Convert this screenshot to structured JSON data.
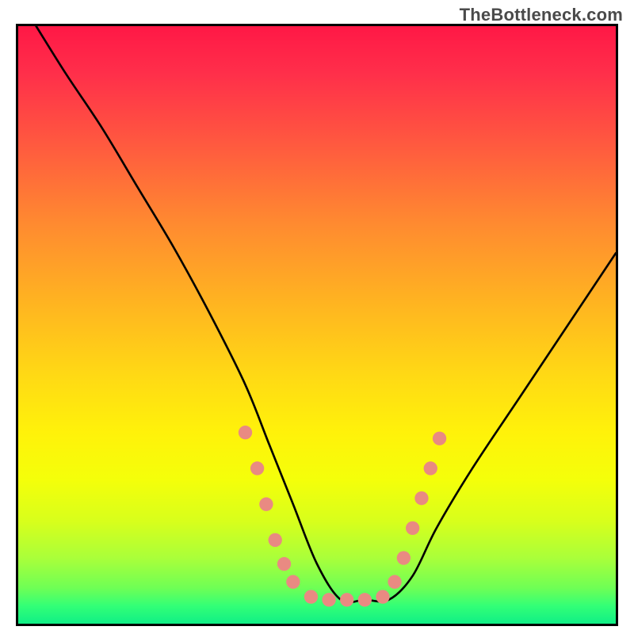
{
  "watermark": "TheBottleneck.com",
  "chart_data": {
    "type": "line",
    "title": "",
    "xlabel": "",
    "ylabel": "",
    "xlim": [
      0,
      100
    ],
    "ylim": [
      0,
      100
    ],
    "grid": false,
    "series": [
      {
        "name": "curve",
        "x": [
          3,
          8,
          14,
          20,
          26,
          32,
          38,
          42,
          46,
          50,
          54,
          58,
          62,
          66,
          70,
          76,
          84,
          92,
          100
        ],
        "y": [
          100,
          92,
          83,
          73,
          63,
          52,
          40,
          30,
          20,
          10,
          4,
          4,
          4,
          8,
          16,
          26,
          38,
          50,
          62
        ]
      }
    ],
    "markers": {
      "name": "salmon-dots",
      "color": "#e98a82",
      "points": [
        {
          "x": 38,
          "y": 32
        },
        {
          "x": 40,
          "y": 26
        },
        {
          "x": 41.5,
          "y": 20
        },
        {
          "x": 43,
          "y": 14
        },
        {
          "x": 44.5,
          "y": 10
        },
        {
          "x": 46,
          "y": 7
        },
        {
          "x": 49,
          "y": 4.5
        },
        {
          "x": 52,
          "y": 4
        },
        {
          "x": 55,
          "y": 4
        },
        {
          "x": 58,
          "y": 4
        },
        {
          "x": 61,
          "y": 4.5
        },
        {
          "x": 63,
          "y": 7
        },
        {
          "x": 64.5,
          "y": 11
        },
        {
          "x": 66,
          "y": 16
        },
        {
          "x": 67.5,
          "y": 21
        },
        {
          "x": 69,
          "y": 26
        },
        {
          "x": 70.5,
          "y": 31
        }
      ]
    },
    "background_gradient": {
      "stops": [
        {
          "pos": 0,
          "color": "#ff1846"
        },
        {
          "pos": 8,
          "color": "#ff2f4a"
        },
        {
          "pos": 20,
          "color": "#ff5a3f"
        },
        {
          "pos": 33,
          "color": "#ff8a30"
        },
        {
          "pos": 46,
          "color": "#ffb321"
        },
        {
          "pos": 58,
          "color": "#ffd815"
        },
        {
          "pos": 68,
          "color": "#fff20a"
        },
        {
          "pos": 76,
          "color": "#f4ff0a"
        },
        {
          "pos": 83,
          "color": "#d7ff1c"
        },
        {
          "pos": 89,
          "color": "#aaff3a"
        },
        {
          "pos": 94,
          "color": "#6fff55"
        },
        {
          "pos": 97,
          "color": "#33ff76"
        },
        {
          "pos": 100,
          "color": "#10ef86"
        }
      ]
    }
  }
}
